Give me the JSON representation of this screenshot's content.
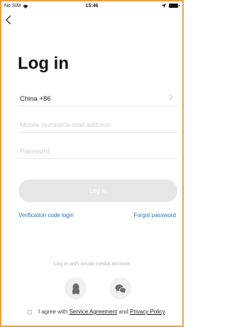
{
  "status_bar": {
    "carrier": "No SIM",
    "time": "15:46"
  },
  "title": "Log in",
  "country": {
    "value": "China +86"
  },
  "mobile": {
    "placeholder": "Mobile number/e-mail address"
  },
  "password": {
    "placeholder": "Password"
  },
  "login_button": {
    "label": "Log in"
  },
  "links": {
    "verification_code_login": "Verification code login",
    "forgot_password": "Forgot password"
  },
  "social": {
    "title": "Log in with social media account",
    "providers": [
      "qq-icon",
      "wechat-icon"
    ]
  },
  "agreement": {
    "prefix": "I agree with",
    "service_agreement": "Service Agreement",
    "connector": "and",
    "privacy_policy": "Privacy Policy"
  },
  "colors": {
    "link": "#2e6fb0",
    "button_disabled": "#e6e6e6",
    "frame_border": "#f0a040"
  }
}
